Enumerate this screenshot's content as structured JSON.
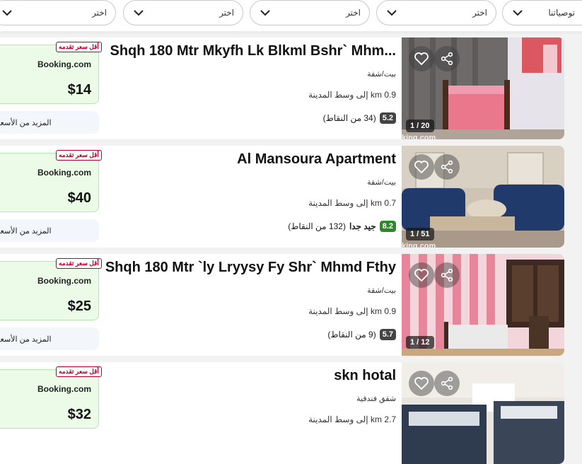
{
  "filters": [
    {
      "label": "توصياتنا"
    },
    {
      "label": "اختر"
    },
    {
      "label": "اختر"
    },
    {
      "label": "اختر"
    },
    {
      "label": "اختر"
    }
  ],
  "listings": [
    {
      "title": "Shqh 180 Mtr Mkyfh Lk Blkml Bshr` Mhm...",
      "property_type": "بيت/شقة",
      "distance": "0.9 km إلى وسط المدينة",
      "rating_score": "5.2",
      "rating_text": "",
      "rating_count": "(34 من النقاط)",
      "deal_badge": "أقل سعر تقدمه",
      "provider": "Booking.com",
      "price": "$14",
      "more_prices": "المزيد من الأسعار",
      "photo_counter": "1 / 20",
      "watermark": "king.com"
    },
    {
      "title": "Al Mansoura Apartment",
      "property_type": "بيت/شقة",
      "distance": "0.7 km إلى وسط المدينة",
      "rating_score": "8.2",
      "rating_text": "جيد جدا",
      "rating_count": "(132 من النقاط)",
      "deal_badge": "أقل سعر تقدمه",
      "provider": "Booking.com",
      "price": "$40",
      "more_prices": "المزيد من الأسعار",
      "photo_counter": "1 / 51",
      "watermark": "king.com"
    },
    {
      "title": "Shqh 180 Mtr `ly Lryysy Fy Shr` Mhmd Fthy",
      "property_type": "بيت/شقة",
      "distance": "0.9 km إلى وسط المدينة",
      "rating_score": "5.7",
      "rating_text": "",
      "rating_count": "(9 من النقاط)",
      "deal_badge": "أقل سعر تقدمه",
      "provider": "Booking.com",
      "price": "$25",
      "more_prices": "المزيد من الأسعار",
      "photo_counter": "1 / 12",
      "watermark": ""
    },
    {
      "title": "skn hotal",
      "property_type": "شقق فندقية",
      "distance": "2.7 km إلى وسط المدينة",
      "rating_score": "",
      "rating_text": "",
      "rating_count": "",
      "deal_badge": "أقل سعر تقدمه",
      "provider": "Booking.com",
      "price": "$32",
      "more_prices": "المزيد من الأسعار",
      "photo_counter": "",
      "watermark": ""
    }
  ]
}
